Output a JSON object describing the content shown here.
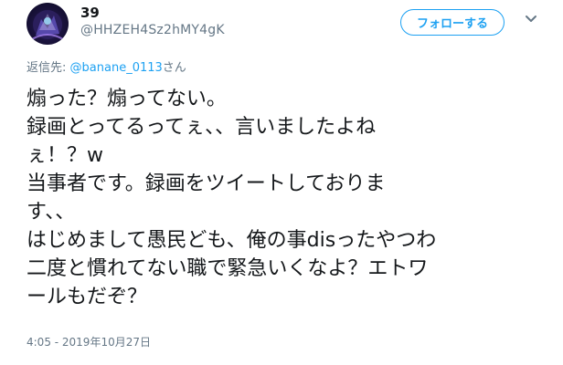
{
  "tweet": {
    "display_name": "39",
    "handle": "@HHZEH4Sz2hMY4gK",
    "follow_label": "フォローする",
    "reply_prefix": "返信先:",
    "reply_mention": "@banane_0113",
    "reply_suffix": "さん",
    "text_lines": [
      "煽った？煽ってない。",
      "録画とってるってぇ、、言いましたよね",
      "ぇ！？w",
      "当事者です。録画をツイートしておりま",
      "す、、",
      "はじめまして愚民ども、俺の事disったやつわ",
      "二度と慣れてない職で緊急いくなよ？エトワ",
      "ールもだぞ？"
    ],
    "timestamp": "4:05 - 2019年10月27日"
  },
  "colors": {
    "accent": "#1da1f2",
    "secondary_text": "#657786",
    "primary_text": "#14171a"
  },
  "icons": {
    "avatar": "avatar-image",
    "menu": "chevron-down-icon"
  }
}
